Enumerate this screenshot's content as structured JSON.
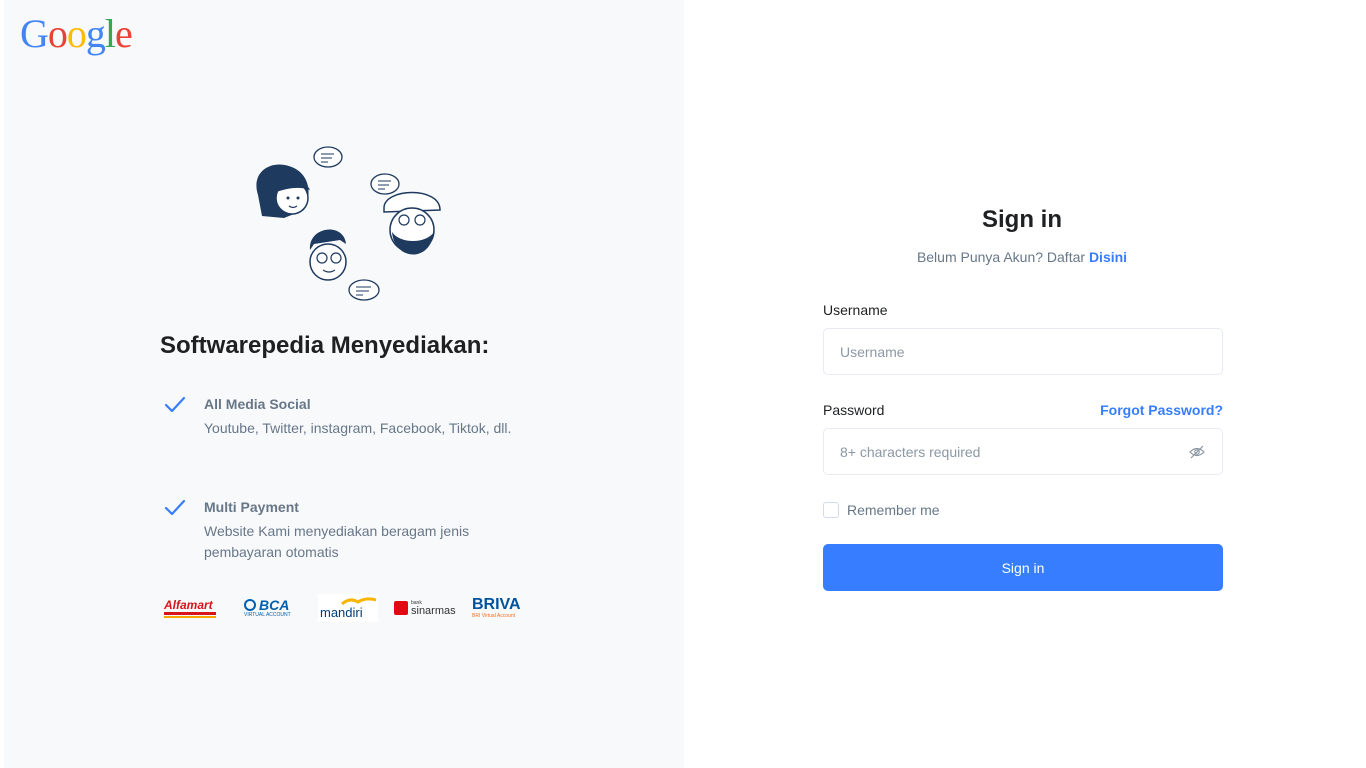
{
  "brand": {
    "logo_letters": [
      "G",
      "o",
      "o",
      "g",
      "l",
      "e"
    ]
  },
  "left": {
    "heading": "Softwarepedia Menyediakan:",
    "features": [
      {
        "title": "All Media Social",
        "desc": "Youtube, Twitter, instagram, Facebook, Tiktok, dll."
      },
      {
        "title": "Multi Payment",
        "desc": "Website Kami menyediakan beragam jenis pembayaran otomatis"
      }
    ],
    "payments": [
      {
        "name": "Alfamart",
        "sub": ""
      },
      {
        "name": "BCA",
        "sub": "VIRTUAL ACCOUNT"
      },
      {
        "name": "mandiri",
        "sub": ""
      },
      {
        "name": "sinarmas",
        "sub": "bank"
      },
      {
        "name": "BRIVA",
        "sub": "BRI Virtual Account"
      }
    ]
  },
  "form": {
    "title": "Sign in",
    "subtitle_prefix": "Belum Punya Akun? Daftar",
    "subtitle_link": "Disini",
    "username_label": "Username",
    "username_placeholder": "Username",
    "password_label": "Password",
    "forgot_link": "Forgot Password?",
    "password_placeholder": "8+ characters required",
    "remember_label": "Remember me",
    "submit_label": "Sign in"
  },
  "colors": {
    "accent": "#377dff",
    "left_bg": "#f8f9fb",
    "muted_text": "#677788"
  }
}
